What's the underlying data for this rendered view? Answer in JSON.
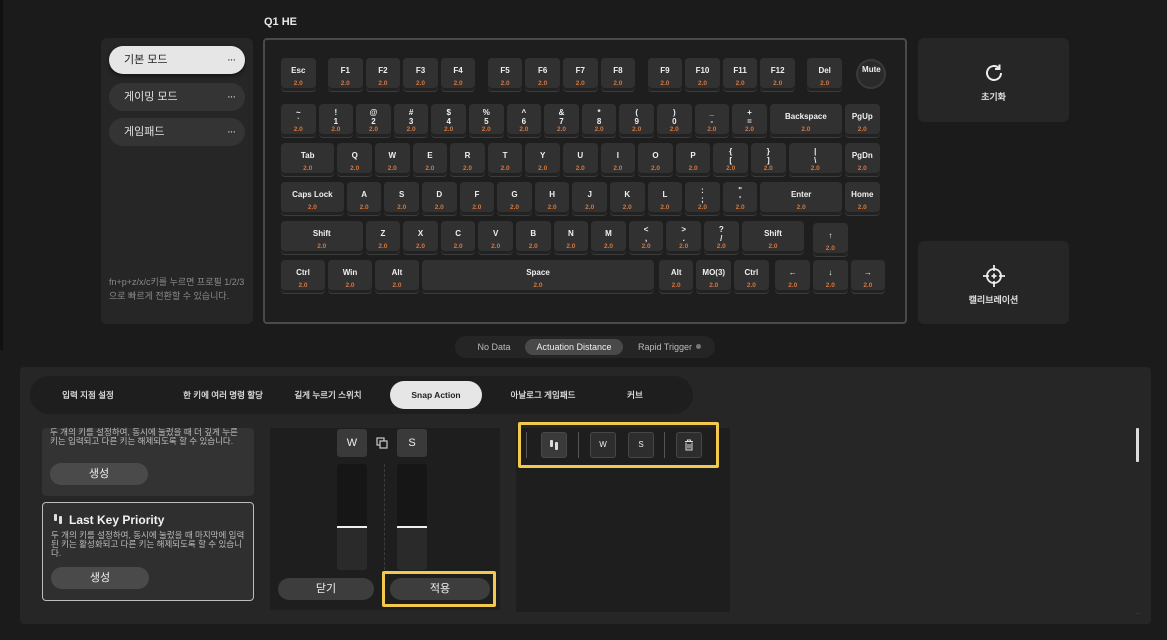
{
  "device_title": "Q1 HE",
  "profiles": {
    "items": [
      {
        "label": "기본 모드",
        "more": "···"
      },
      {
        "label": "게이밍 모드",
        "more": "···"
      },
      {
        "label": "게임패드",
        "more": "···"
      }
    ],
    "hint": "fn+p+z/x/c키를 누르면 프로필 1/2/3으로 빠르게 전환할 수 있습니다."
  },
  "keyboard": {
    "rows": [
      [
        {
          "l": "Esc",
          "v": "2.0"
        },
        {
          "l": "F1",
          "v": "2.0"
        },
        {
          "l": "F2",
          "v": "2.0"
        },
        {
          "l": "F3",
          "v": "2.0"
        },
        {
          "l": "F4",
          "v": "2.0"
        },
        {
          "l": "F5",
          "v": "2.0"
        },
        {
          "l": "F6",
          "v": "2.0"
        },
        {
          "l": "F7",
          "v": "2.0"
        },
        {
          "l": "F8",
          "v": "2.0"
        },
        {
          "l": "F9",
          "v": "2.0"
        },
        {
          "l": "F10",
          "v": "2.0"
        },
        {
          "l": "F11",
          "v": "2.0"
        },
        {
          "l": "F12",
          "v": "2.0"
        },
        {
          "l": "Del",
          "v": "2.0"
        },
        {
          "l": "Mute",
          "v": ""
        }
      ],
      [
        {
          "l": "~\n`",
          "v": "2.0"
        },
        {
          "l": "!\n1",
          "v": "2.0"
        },
        {
          "l": "@\n2",
          "v": "2.0"
        },
        {
          "l": "#\n3",
          "v": "2.0"
        },
        {
          "l": "$\n4",
          "v": "2.0"
        },
        {
          "l": "%\n5",
          "v": "2.0"
        },
        {
          "l": "^\n6",
          "v": "2.0"
        },
        {
          "l": "&\n7",
          "v": "2.0"
        },
        {
          "l": "*\n8",
          "v": "2.0"
        },
        {
          "l": "(\n9",
          "v": "2.0"
        },
        {
          "l": ")\n0",
          "v": "2.0"
        },
        {
          "l": "_\n-",
          "v": "2.0"
        },
        {
          "l": "+\n=",
          "v": "2.0"
        },
        {
          "l": "Backspace",
          "v": "2.0"
        },
        {
          "l": "PgUp",
          "v": "2.0"
        }
      ],
      [
        {
          "l": "Tab",
          "v": "2.0"
        },
        {
          "l": "Q",
          "v": "2.0"
        },
        {
          "l": "W",
          "v": "2.0"
        },
        {
          "l": "E",
          "v": "2.0"
        },
        {
          "l": "R",
          "v": "2.0"
        },
        {
          "l": "T",
          "v": "2.0"
        },
        {
          "l": "Y",
          "v": "2.0"
        },
        {
          "l": "U",
          "v": "2.0"
        },
        {
          "l": "I",
          "v": "2.0"
        },
        {
          "l": "O",
          "v": "2.0"
        },
        {
          "l": "P",
          "v": "2.0"
        },
        {
          "l": "{\n[",
          "v": "2.0"
        },
        {
          "l": "}\n]",
          "v": "2.0"
        },
        {
          "l": "|\n\\",
          "v": "2.0"
        },
        {
          "l": "PgDn",
          "v": "2.0"
        }
      ],
      [
        {
          "l": "Caps Lock",
          "v": "2.0"
        },
        {
          "l": "A",
          "v": "2.0"
        },
        {
          "l": "S",
          "v": "2.0"
        },
        {
          "l": "D",
          "v": "2.0"
        },
        {
          "l": "F",
          "v": "2.0"
        },
        {
          "l": "G",
          "v": "2.0"
        },
        {
          "l": "H",
          "v": "2.0"
        },
        {
          "l": "J",
          "v": "2.0"
        },
        {
          "l": "K",
          "v": "2.0"
        },
        {
          "l": "L",
          "v": "2.0"
        },
        {
          "l": ":\n;",
          "v": "2.0"
        },
        {
          "l": "\"\n'",
          "v": "2.0"
        },
        {
          "l": "Enter",
          "v": "2.0"
        },
        {
          "l": "Home",
          "v": "2.0"
        }
      ],
      [
        {
          "l": "Shift",
          "v": "2.0"
        },
        {
          "l": "Z",
          "v": "2.0"
        },
        {
          "l": "X",
          "v": "2.0"
        },
        {
          "l": "C",
          "v": "2.0"
        },
        {
          "l": "V",
          "v": "2.0"
        },
        {
          "l": "B",
          "v": "2.0"
        },
        {
          "l": "N",
          "v": "2.0"
        },
        {
          "l": "M",
          "v": "2.0"
        },
        {
          "l": "<\n,",
          "v": "2.0"
        },
        {
          "l": ">\n.",
          "v": "2.0"
        },
        {
          "l": "?\n/",
          "v": "2.0"
        },
        {
          "l": "Shift",
          "v": "2.0"
        },
        {
          "l": "↑",
          "v": "2.0"
        }
      ],
      [
        {
          "l": "Ctrl",
          "v": "2.0"
        },
        {
          "l": "Win",
          "v": "2.0"
        },
        {
          "l": "Alt",
          "v": "2.0"
        },
        {
          "l": "Space",
          "v": "2.0"
        },
        {
          "l": "Alt",
          "v": "2.0"
        },
        {
          "l": "MO(3)",
          "v": "2.0"
        },
        {
          "l": "Ctrl",
          "v": "2.0"
        },
        {
          "l": "←",
          "v": "2.0"
        },
        {
          "l": "↓",
          "v": "2.0"
        },
        {
          "l": "→",
          "v": "2.0"
        }
      ]
    ]
  },
  "actions": {
    "reset_label": "초기화",
    "calibrate_label": "캘리브레이션",
    "reset_icon": "refresh-icon",
    "calibrate_icon": "crosshair-icon"
  },
  "mode_toggle": {
    "options": [
      "No Data",
      "Actuation Distance",
      "Rapid Trigger"
    ],
    "active": "Actuation Distance"
  },
  "tabs": {
    "items": [
      "입력 지점 설정",
      "한 키에 여러 명령 할당",
      "길게 누르기 스위치",
      "Snap Action",
      "아날로그 게임패드",
      "커브"
    ],
    "active": "Snap Action"
  },
  "snap_cards": [
    {
      "title": "",
      "desc": "두 개의 키를 설정하여, 동시에 눌렀을 때 더 깊게 누른 키는 입력되고 다른 키는 해제되도록 할 수 있습니다.",
      "button": "생성"
    },
    {
      "title": "Last Key Priority",
      "desc": "두 개의 키를 설정하여, 동시에 눌렀을 때 마지막에 입력된 키는 활성화되고 다른 키는 해제되도록 할 수 있습니다.",
      "button": "생성"
    }
  ],
  "editor": {
    "key_a": "W",
    "key_b": "S",
    "swap_icon": "swap-icon",
    "track_a_level": 0.4,
    "track_b_level": 0.4,
    "close_label": "닫기",
    "apply_label": "적용"
  },
  "result": {
    "icon": "snap-action-icon",
    "key_a": "W",
    "key_b": "S",
    "delete_icon": "trash-icon"
  },
  "colors": {
    "accent_highlight": "#f2c94c",
    "travel_value": "#d4763f"
  }
}
